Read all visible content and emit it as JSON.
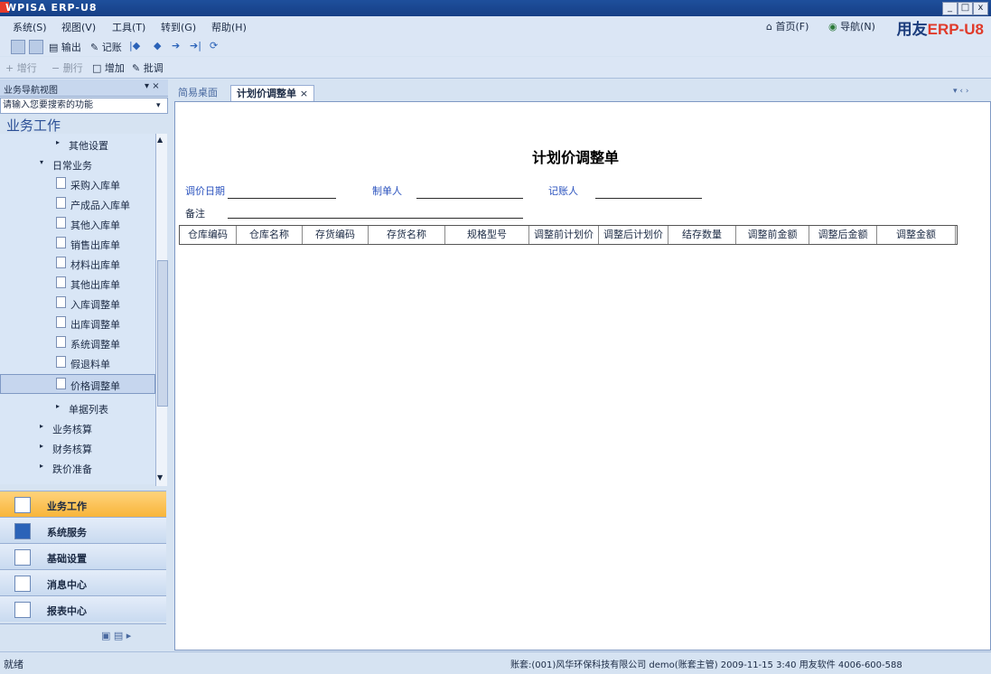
{
  "window": {
    "title": "WPISA ERP-U8",
    "min": "_",
    "max": "□",
    "close": "x"
  },
  "menu": [
    "系统(S)",
    "视图(V)",
    "工具(T)",
    "转到(G)",
    "帮助(H)"
  ],
  "top_links": {
    "home": "首页(F)",
    "nav": "导航(N)"
  },
  "brand": {
    "main": "用友",
    "accent": "ERP-U8"
  },
  "toolbar1": {
    "output": "输出",
    "record": "记账"
  },
  "toolbar2": {
    "add_row": "增行",
    "del_row": "删行",
    "add": "增加",
    "batch": "批调"
  },
  "nav_panel": {
    "header": "业务导航视图",
    "pin": "▾ ×",
    "search_placeholder": "请输入您要搜索的功能",
    "title": "业务工作",
    "tree": [
      {
        "label": "其他设置",
        "kind": "arrow"
      },
      {
        "label": "日常业务",
        "kind": "open"
      },
      {
        "label": "采购入库单",
        "kind": "doc"
      },
      {
        "label": "产成品入库单",
        "kind": "doc"
      },
      {
        "label": "其他入库单",
        "kind": "doc"
      },
      {
        "label": "销售出库单",
        "kind": "doc"
      },
      {
        "label": "材料出库单",
        "kind": "doc"
      },
      {
        "label": "其他出库单",
        "kind": "doc"
      },
      {
        "label": "入库调整单",
        "kind": "doc"
      },
      {
        "label": "出库调整单",
        "kind": "doc"
      },
      {
        "label": "系统调整单",
        "kind": "doc"
      },
      {
        "label": "假退料单",
        "kind": "doc"
      },
      {
        "label": "价格调整单",
        "kind": "doc"
      },
      {
        "label": "单据列表",
        "kind": "arrow"
      },
      {
        "label": "业务核算",
        "kind": "arrow"
      },
      {
        "label": "财务核算",
        "kind": "arrow"
      },
      {
        "label": "跌价准备",
        "kind": "arrow"
      }
    ],
    "buttons": [
      "业务工作",
      "系统服务",
      "基础设置",
      "消息中心",
      "报表中心"
    ]
  },
  "tabs": {
    "desktop": "简易桌面",
    "active": "计划价调整单",
    "close": "×",
    "nav_arrows": "▾ ‹ ›"
  },
  "form": {
    "title": "计划价调整单",
    "adjust_date_label": "调价日期",
    "maker_label": "制单人",
    "bookkeeper_label": "记账人",
    "remark_label": "备注",
    "columns": [
      "仓库编码",
      "仓库名称",
      "存货编码",
      "存货名称",
      "规格型号",
      "调整前计划价",
      "调整后计划价",
      "结存数量",
      "调整前金额",
      "调整后金额",
      "调整金额"
    ]
  },
  "status": {
    "left": "就绪",
    "right": "账套:(001)风华环保科技有限公司  demo(账套主管)  2009-11-15 3:40  用友软件 4006-600-588"
  },
  "colors": {
    "accent": "#f8b53a",
    "title_bar": "#1e4f9c",
    "label_blue": "#2a52be",
    "brand_red": "#e03a2a"
  }
}
